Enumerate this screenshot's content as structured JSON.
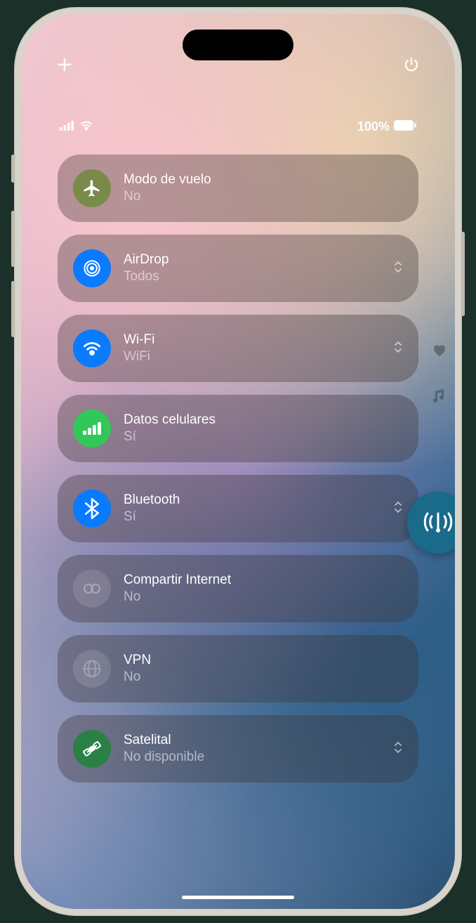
{
  "status": {
    "battery": "100%"
  },
  "controls": [
    {
      "title": "Modo de vuelo",
      "status": "No",
      "icon": "airplane",
      "color": "olive",
      "expand": false
    },
    {
      "title": "AirDrop",
      "status": "Todos",
      "icon": "airdrop",
      "color": "blue",
      "expand": true
    },
    {
      "title": "Wi-Fi",
      "status": "WiFi",
      "icon": "wifi",
      "color": "blue",
      "expand": true
    },
    {
      "title": "Datos celulares",
      "status": "Sí",
      "icon": "cellular",
      "color": "green",
      "expand": false
    },
    {
      "title": "Bluetooth",
      "status": "Sí",
      "icon": "bluetooth",
      "color": "blue",
      "expand": true
    },
    {
      "title": "Compartir Internet",
      "status": "No",
      "icon": "hotspot",
      "color": "inactive",
      "expand": false
    },
    {
      "title": "VPN",
      "status": "No",
      "icon": "vpn",
      "color": "inactive",
      "expand": false
    },
    {
      "title": "Satelital",
      "status": "No disponible",
      "icon": "satellite",
      "color": "darkgreen",
      "expand": true
    }
  ]
}
